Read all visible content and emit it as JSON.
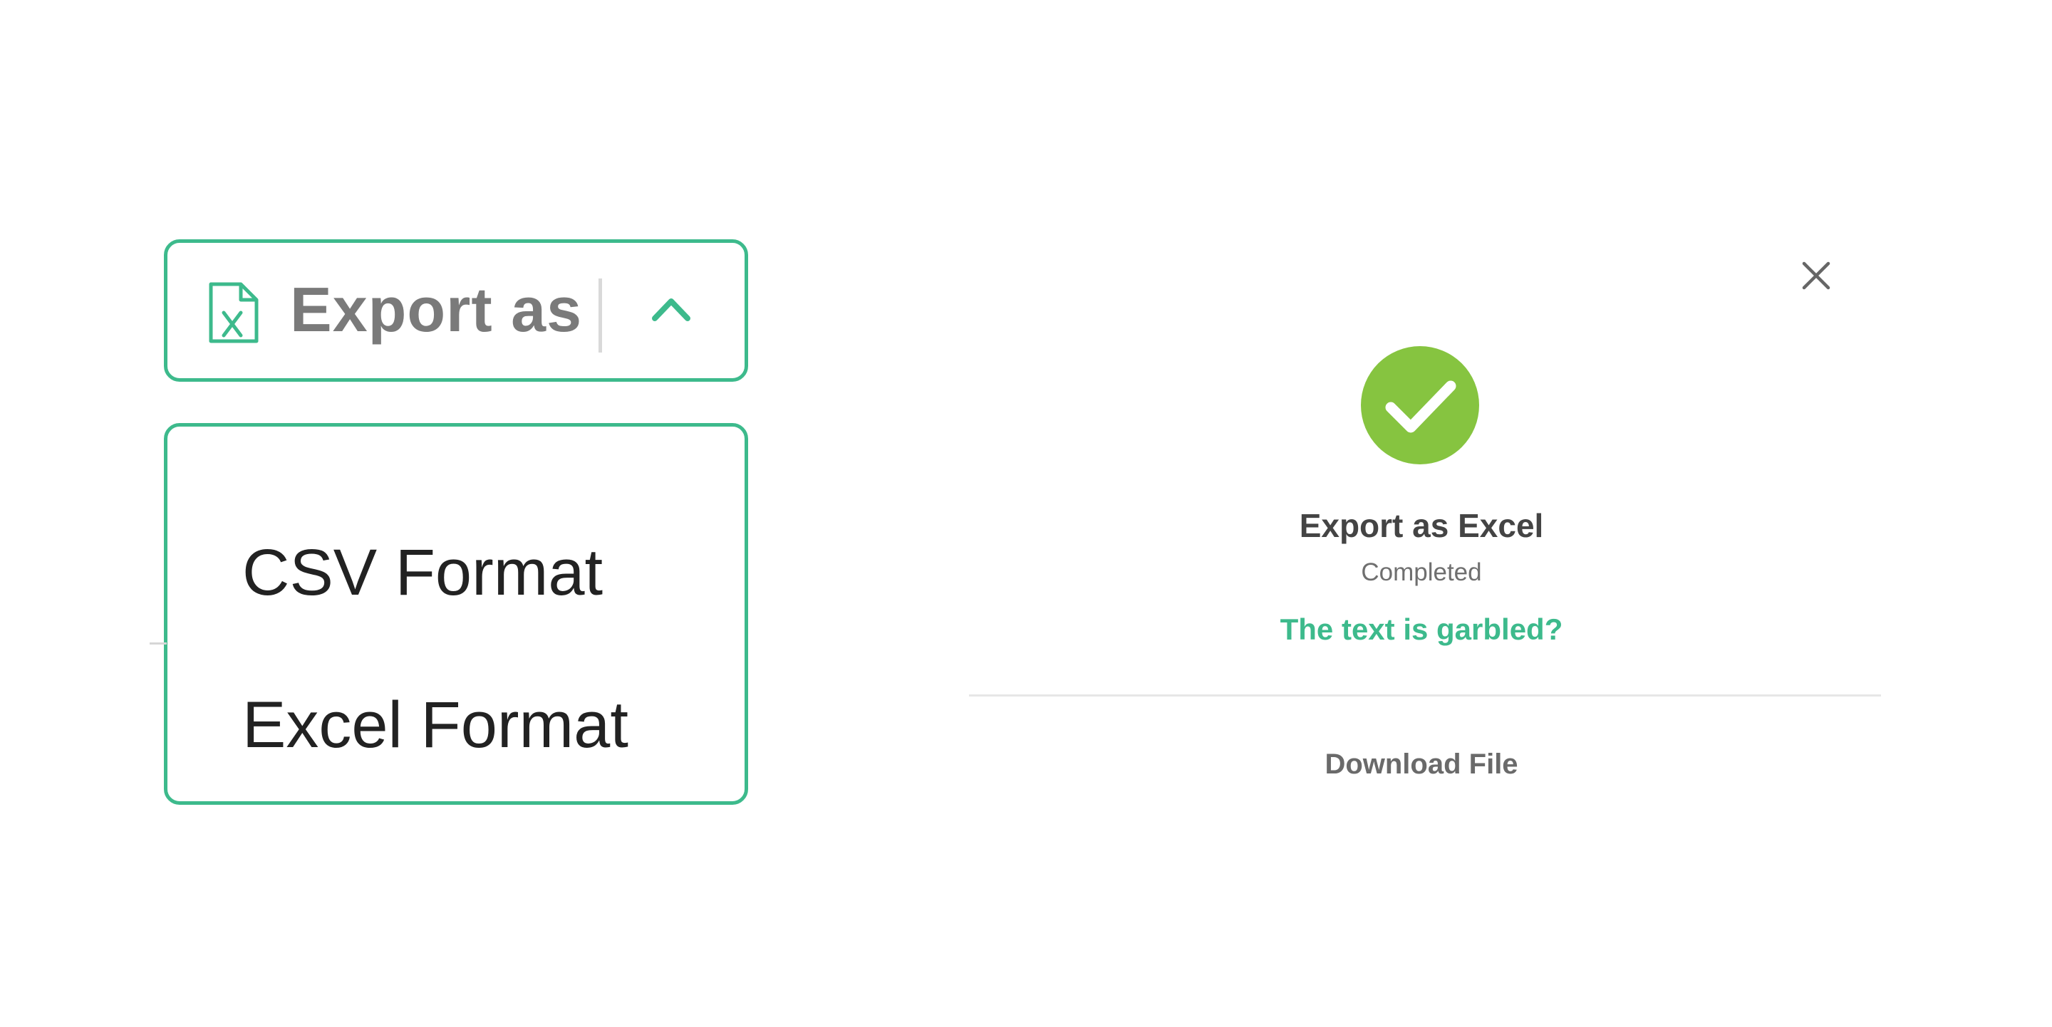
{
  "export_control": {
    "label": "Export as",
    "icon": "excel-file-icon",
    "chevron_icon": "chevron-up-icon",
    "accent_color": "#3dba8c"
  },
  "dropdown": {
    "items": [
      {
        "label": "CSV Format"
      },
      {
        "label": "Excel Format"
      }
    ]
  },
  "dialog": {
    "close_icon": "close-icon",
    "success_icon": "check-circle-icon",
    "success_color": "#86c440",
    "title": "Export as Excel",
    "status": "Completed",
    "help_link": "The text is garbled?",
    "download_label": "Download File"
  }
}
